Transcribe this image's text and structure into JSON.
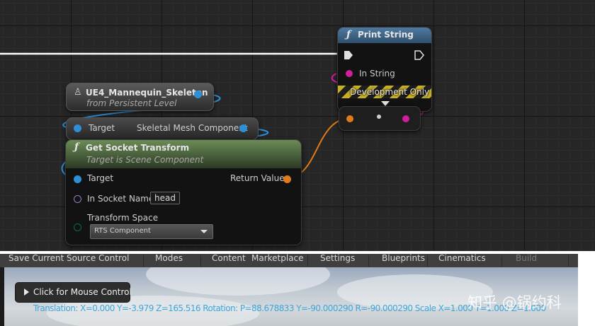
{
  "print_string": {
    "title": "Print String",
    "in_string": "In String",
    "dev_only": "Development Only"
  },
  "skeleton_node": {
    "title": "UE4_Mannequin_Skeleton",
    "subtitle": "from Persistent Level"
  },
  "mesh_node": {
    "target": "Target",
    "component": "Skeletal Mesh Component"
  },
  "socket_node": {
    "title": "Get Socket Transform",
    "subtitle": "Target is Scene Component",
    "target": "Target",
    "return_value": "Return Value",
    "in_socket_name": "In Socket Name",
    "socket_value": "head",
    "transform_space": "Transform Space",
    "transform_space_value": "RTS Component"
  },
  "toolbar": {
    "items": [
      "Save Current",
      "Source Control",
      "Modes",
      "Content",
      "Marketplace",
      "Settings",
      "Blueprints",
      "Cinematics",
      "Build"
    ]
  },
  "viewport": {
    "mouse_control": "Click for Mouse Control",
    "transform_readout": "Translation: X=0.000 Y=-3.979 Z=165.516 Rotation: P=88.678833 Y=-90.000290 R=-90.000290 Scale X=1.000 Y=1.000 Z=1.000"
  },
  "watermark": "知乎 @锅约科",
  "colors": {
    "pin_object": "#2f8fd6",
    "pin_string": "#d01e9e",
    "pin_transform": "#e07a1a",
    "pin_name": "#9a7ac8",
    "pin_enum": "#0a6b4a",
    "exec_wire": "#ffffff",
    "print_header": "#3f6a8e",
    "socket_header": "#5f7f4c"
  }
}
